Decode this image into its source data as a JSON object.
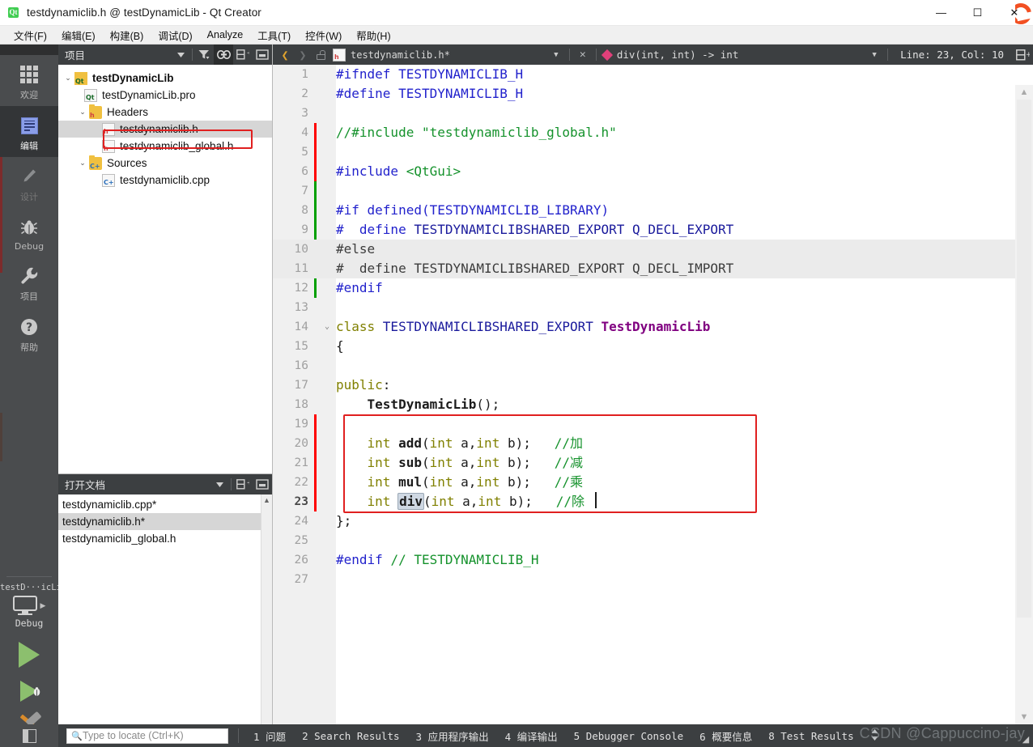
{
  "window": {
    "title": "testdynamiclib.h @ testDynamicLib - Qt Creator",
    "app_icon": "qt-logo-icon",
    "minimize": "—",
    "maximize": "☐",
    "close": "✕"
  },
  "menubar": {
    "items": [
      {
        "label": "文件(F)",
        "name": "menu-file"
      },
      {
        "label": "编辑(E)",
        "name": "menu-edit"
      },
      {
        "label": "构建(B)",
        "name": "menu-build"
      },
      {
        "label": "调试(D)",
        "name": "menu-debug"
      },
      {
        "label": "Analyze",
        "name": "menu-analyze"
      },
      {
        "label": "工具(T)",
        "name": "menu-tools"
      },
      {
        "label": "控件(W)",
        "name": "menu-window"
      },
      {
        "label": "帮助(H)",
        "name": "menu-help"
      }
    ]
  },
  "modebar": {
    "modes": [
      {
        "label": "欢迎",
        "icon": "grid-icon",
        "active": false,
        "disabled": false
      },
      {
        "label": "编辑",
        "icon": "document-icon",
        "active": true,
        "disabled": false
      },
      {
        "label": "设计",
        "icon": "pencil-icon",
        "active": false,
        "disabled": true
      },
      {
        "label": "Debug",
        "icon": "bug-icon",
        "active": false,
        "disabled": false
      },
      {
        "label": "项目",
        "icon": "wrench-icon",
        "active": false,
        "disabled": false
      },
      {
        "label": "帮助",
        "icon": "question-circle-icon",
        "active": false,
        "disabled": false
      }
    ],
    "kit": {
      "project_name": "testD···icLib",
      "build_config": "Debug",
      "target_icon": "monitor-icon",
      "run_icon": "run-triangle-icon",
      "debug_icon": "debug-triangle-bug-icon",
      "build_icon": "hammer-icon"
    }
  },
  "project_panel": {
    "title": "项目",
    "toolbar": [
      {
        "name": "filter-icon",
        "glyph": "▼"
      },
      {
        "name": "filter-funnel-icon",
        "glyph": "▼"
      },
      {
        "name": "link-sync-icon",
        "glyph": "⛓"
      },
      {
        "name": "split-add-icon",
        "glyph": "⊞"
      },
      {
        "name": "collapse-panel-icon",
        "glyph": "▣"
      }
    ],
    "tree": [
      {
        "label": "testDynamicLib",
        "indent": 0,
        "chevron": "⌄",
        "icon": "qt-project-folder-icon",
        "tag": "Qt",
        "bold": true,
        "selected": false
      },
      {
        "label": "testDynamicLib.pro",
        "indent": 1,
        "chevron": "",
        "icon": "qt-pro-file-icon",
        "tag": "Qt",
        "bold": false,
        "selected": false
      },
      {
        "label": "Headers",
        "indent": 1,
        "chevron": "⌄",
        "icon": "headers-folder-icon",
        "tag": "h",
        "bold": false,
        "selected": false
      },
      {
        "label": "testdynamiclib.h",
        "indent": 2,
        "chevron": "",
        "icon": "header-file-icon",
        "tag": "h",
        "bold": false,
        "selected": true
      },
      {
        "label": "testdynamiclib_global.h",
        "indent": 2,
        "chevron": "",
        "icon": "header-file-icon",
        "tag": "h",
        "bold": false,
        "selected": false
      },
      {
        "label": "Sources",
        "indent": 1,
        "chevron": "⌄",
        "icon": "sources-folder-icon",
        "tag": "C+",
        "bold": false,
        "selected": false
      },
      {
        "label": "testdynamiclib.cpp",
        "indent": 2,
        "chevron": "",
        "icon": "cpp-file-icon",
        "tag": "C+",
        "bold": false,
        "selected": false
      }
    ]
  },
  "open_documents": {
    "title": "打开文档",
    "toolbar": [
      {
        "name": "documents-dropdown-icon",
        "glyph": "▼"
      },
      {
        "name": "split-add-icon",
        "glyph": "⊞"
      },
      {
        "name": "collapse-panel-icon",
        "glyph": "▣"
      }
    ],
    "items": [
      {
        "label": "testdynamiclib.cpp*",
        "selected": false
      },
      {
        "label": "testdynamiclib.h*",
        "selected": true
      },
      {
        "label": "testdynamiclib_global.h",
        "selected": false
      }
    ]
  },
  "editor_toolbar": {
    "back_icon": "back-arrow-icon",
    "forward_icon": "forward-arrow-icon",
    "lock_icon": "unlock-icon",
    "file_name": "testdynamiclib.h*",
    "file_icon": "header-file-icon",
    "file_dropdown_icon": "chevron-down-icon",
    "close_icon": "close-icon",
    "symbol_icon": "function-diamond-icon",
    "symbol_name": "div(int, int) -> int",
    "symbol_dropdown_icon": "chevron-down-icon",
    "line_col": "Line: 23, Col: 10",
    "split_icon": "split-editor-icon"
  },
  "code": {
    "current_line": 23,
    "lines": [
      {
        "n": 1,
        "fold": "",
        "change": "",
        "disabled": false,
        "tokens": [
          {
            "t": "#ifndef TESTDYNAMICLIB_H",
            "c": "pp"
          }
        ]
      },
      {
        "n": 2,
        "fold": "",
        "change": "",
        "disabled": false,
        "tokens": [
          {
            "t": "#define TESTDYNAMICLIB_H",
            "c": "pp"
          }
        ]
      },
      {
        "n": 3,
        "fold": "",
        "change": "",
        "disabled": false,
        "tokens": []
      },
      {
        "n": 4,
        "fold": "",
        "change": "red",
        "disabled": false,
        "tokens": [
          {
            "t": "//#include \"testdynamiclib_global.h\"",
            "c": "cm"
          }
        ]
      },
      {
        "n": 5,
        "fold": "",
        "change": "red",
        "disabled": false,
        "tokens": []
      },
      {
        "n": 6,
        "fold": "",
        "change": "red",
        "disabled": false,
        "tokens": [
          {
            "t": "#include ",
            "c": "pp"
          },
          {
            "t": "<QtGui>",
            "c": "str"
          }
        ]
      },
      {
        "n": 7,
        "fold": "",
        "change": "green",
        "disabled": false,
        "tokens": []
      },
      {
        "n": 8,
        "fold": "",
        "change": "green",
        "disabled": false,
        "tokens": [
          {
            "t": "#if defined(TESTDYNAMICLIB_LIBRARY)",
            "c": "pp"
          }
        ]
      },
      {
        "n": 9,
        "fold": "",
        "change": "green",
        "disabled": false,
        "tokens": [
          {
            "t": "#  define ",
            "c": "pp"
          },
          {
            "t": "TESTDYNAMICLIBSHARED_EXPORT Q_DECL_EXPORT",
            "c": "typ"
          }
        ]
      },
      {
        "n": 10,
        "fold": "",
        "change": "green",
        "disabled": true,
        "tokens": [
          {
            "t": "#else",
            "c": "pp"
          }
        ]
      },
      {
        "n": 11,
        "fold": "",
        "change": "green",
        "disabled": true,
        "tokens": [
          {
            "t": "#  define TESTDYNAMICLIBSHARED_EXPORT Q_DECL_IMPORT",
            "c": "pl"
          }
        ]
      },
      {
        "n": 12,
        "fold": "",
        "change": "green",
        "disabled": false,
        "tokens": [
          {
            "t": "#endif",
            "c": "pp"
          }
        ]
      },
      {
        "n": 13,
        "fold": "",
        "change": "",
        "disabled": false,
        "tokens": []
      },
      {
        "n": 14,
        "fold": "⌄",
        "change": "",
        "disabled": false,
        "tokens": [
          {
            "t": "class ",
            "c": "kw"
          },
          {
            "t": "TESTDYNAMICLIBSHARED_EXPORT ",
            "c": "typ"
          },
          {
            "t": "TestDynamicLib",
            "c": "cls"
          }
        ]
      },
      {
        "n": 15,
        "fold": "",
        "change": "",
        "disabled": false,
        "tokens": [
          {
            "t": "{",
            "c": "pl"
          }
        ]
      },
      {
        "n": 16,
        "fold": "",
        "change": "",
        "disabled": false,
        "tokens": []
      },
      {
        "n": 17,
        "fold": "",
        "change": "",
        "disabled": false,
        "tokens": [
          {
            "t": "public",
            "c": "kw"
          },
          {
            "t": ":",
            "c": "pl"
          }
        ]
      },
      {
        "n": 18,
        "fold": "",
        "change": "",
        "disabled": false,
        "tokens": [
          {
            "t": "    ",
            "c": "pl"
          },
          {
            "t": "TestDynamicLib",
            "c": "fn"
          },
          {
            "t": "();",
            "c": "pl"
          }
        ]
      },
      {
        "n": 19,
        "fold": "",
        "change": "red",
        "disabled": false,
        "tokens": []
      },
      {
        "n": 20,
        "fold": "",
        "change": "red",
        "disabled": false,
        "tokens": [
          {
            "t": "    ",
            "c": "pl"
          },
          {
            "t": "int ",
            "c": "kw"
          },
          {
            "t": "add",
            "c": "fn"
          },
          {
            "t": "(",
            "c": "pl"
          },
          {
            "t": "int ",
            "c": "kw"
          },
          {
            "t": "a",
            "c": "pl"
          },
          {
            "t": ",",
            "c": "pl"
          },
          {
            "t": "int ",
            "c": "kw"
          },
          {
            "t": "b",
            "c": "pl"
          },
          {
            "t": ");   ",
            "c": "pl"
          },
          {
            "t": "//加",
            "c": "cm"
          }
        ]
      },
      {
        "n": 21,
        "fold": "",
        "change": "red",
        "disabled": false,
        "tokens": [
          {
            "t": "    ",
            "c": "pl"
          },
          {
            "t": "int ",
            "c": "kw"
          },
          {
            "t": "sub",
            "c": "fn"
          },
          {
            "t": "(",
            "c": "pl"
          },
          {
            "t": "int ",
            "c": "kw"
          },
          {
            "t": "a",
            "c": "pl"
          },
          {
            "t": ",",
            "c": "pl"
          },
          {
            "t": "int ",
            "c": "kw"
          },
          {
            "t": "b",
            "c": "pl"
          },
          {
            "t": ");   ",
            "c": "pl"
          },
          {
            "t": "//减",
            "c": "cm"
          }
        ]
      },
      {
        "n": 22,
        "fold": "",
        "change": "red",
        "disabled": false,
        "tokens": [
          {
            "t": "    ",
            "c": "pl"
          },
          {
            "t": "int ",
            "c": "kw"
          },
          {
            "t": "mul",
            "c": "fn"
          },
          {
            "t": "(",
            "c": "pl"
          },
          {
            "t": "int ",
            "c": "kw"
          },
          {
            "t": "a",
            "c": "pl"
          },
          {
            "t": ",",
            "c": "pl"
          },
          {
            "t": "int ",
            "c": "kw"
          },
          {
            "t": "b",
            "c": "pl"
          },
          {
            "t": ");   ",
            "c": "pl"
          },
          {
            "t": "//乘",
            "c": "cm"
          }
        ]
      },
      {
        "n": 23,
        "fold": "",
        "change": "red",
        "disabled": false,
        "tokens": [
          {
            "t": "    ",
            "c": "pl"
          },
          {
            "t": "int ",
            "c": "kw"
          },
          {
            "t": "div",
            "c": "occ"
          },
          {
            "t": "(",
            "c": "pl"
          },
          {
            "t": "int ",
            "c": "kw"
          },
          {
            "t": "a",
            "c": "pl"
          },
          {
            "t": ",",
            "c": "pl"
          },
          {
            "t": "int ",
            "c": "kw"
          },
          {
            "t": "b",
            "c": "pl"
          },
          {
            "t": ");   ",
            "c": "pl"
          },
          {
            "t": "//除",
            "c": "cm"
          }
        ]
      },
      {
        "n": 24,
        "fold": "",
        "change": "",
        "disabled": false,
        "tokens": [
          {
            "t": "};",
            "c": "pl"
          }
        ]
      },
      {
        "n": 25,
        "fold": "",
        "change": "",
        "disabled": false,
        "tokens": []
      },
      {
        "n": 26,
        "fold": "",
        "change": "",
        "disabled": false,
        "tokens": [
          {
            "t": "#endif ",
            "c": "pp"
          },
          {
            "t": "// TESTDYNAMICLIB_H",
            "c": "cm"
          }
        ]
      },
      {
        "n": 27,
        "fold": "",
        "change": "",
        "disabled": false,
        "tokens": []
      }
    ]
  },
  "statusbar": {
    "toggle_sidebar_icon": "toggle-sidebar-icon",
    "locator_placeholder": "Type to locate (Ctrl+K)",
    "locator_icon": "search-icon",
    "panes": [
      {
        "num": "1",
        "label": "问题"
      },
      {
        "num": "2",
        "label": "Search Results"
      },
      {
        "num": "3",
        "label": "应用程序输出"
      },
      {
        "num": "4",
        "label": "编译输出"
      },
      {
        "num": "5",
        "label": "Debugger Console"
      },
      {
        "num": "6",
        "label": "概要信息"
      },
      {
        "num": "8",
        "label": "Test Results"
      }
    ],
    "updown_icon": "up-down-arrows-icon",
    "watermark": "CSDN @Cappuccino-jay"
  },
  "colors": {
    "accent_red_highlight": "#e02020",
    "qt_green": "#41cd52",
    "dark_chrome": "#3c3f41",
    "modebar": "#4a4c4e",
    "selection_gray": "#d6d6d6",
    "change_red": "#ff0000",
    "change_green": "#00a000"
  }
}
